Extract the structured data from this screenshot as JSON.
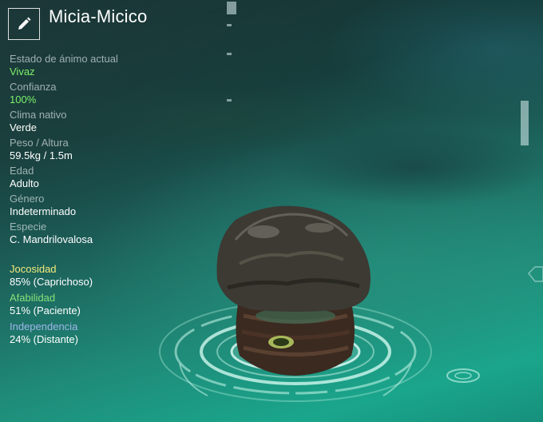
{
  "creature": {
    "name": "Micia-Micico"
  },
  "header": {
    "edit_icon": "pencil-icon"
  },
  "stats": [
    {
      "label": "Estado de ánimo actual",
      "value": "Vivaz",
      "value_color": "#7cf06a"
    },
    {
      "label": "Confianza",
      "value": "100%",
      "value_color": "#7cf06a"
    },
    {
      "label": "Clima nativo",
      "value": "Verde"
    },
    {
      "label": "Peso / Altura",
      "value": "59.5kg / 1.5m"
    },
    {
      "label": "Edad",
      "value": "Adulto"
    },
    {
      "label": "Género",
      "value": "Indeterminado"
    },
    {
      "label": "Especie",
      "value": "C. Mandrilovalosa"
    }
  ],
  "traits": [
    {
      "label": "Jocosidad",
      "value": "85% (Caprichoso)",
      "label_color": "#f2ea7a"
    },
    {
      "label": "Afabilidad",
      "value": "51% (Paciente)",
      "label_color": "#86e07a"
    },
    {
      "label": "Independencia",
      "value": "24% (Distante)",
      "label_color": "#9fb6ea"
    }
  ],
  "colors": {
    "accent_green": "#7cf06a",
    "ring": "#bff5e6"
  }
}
